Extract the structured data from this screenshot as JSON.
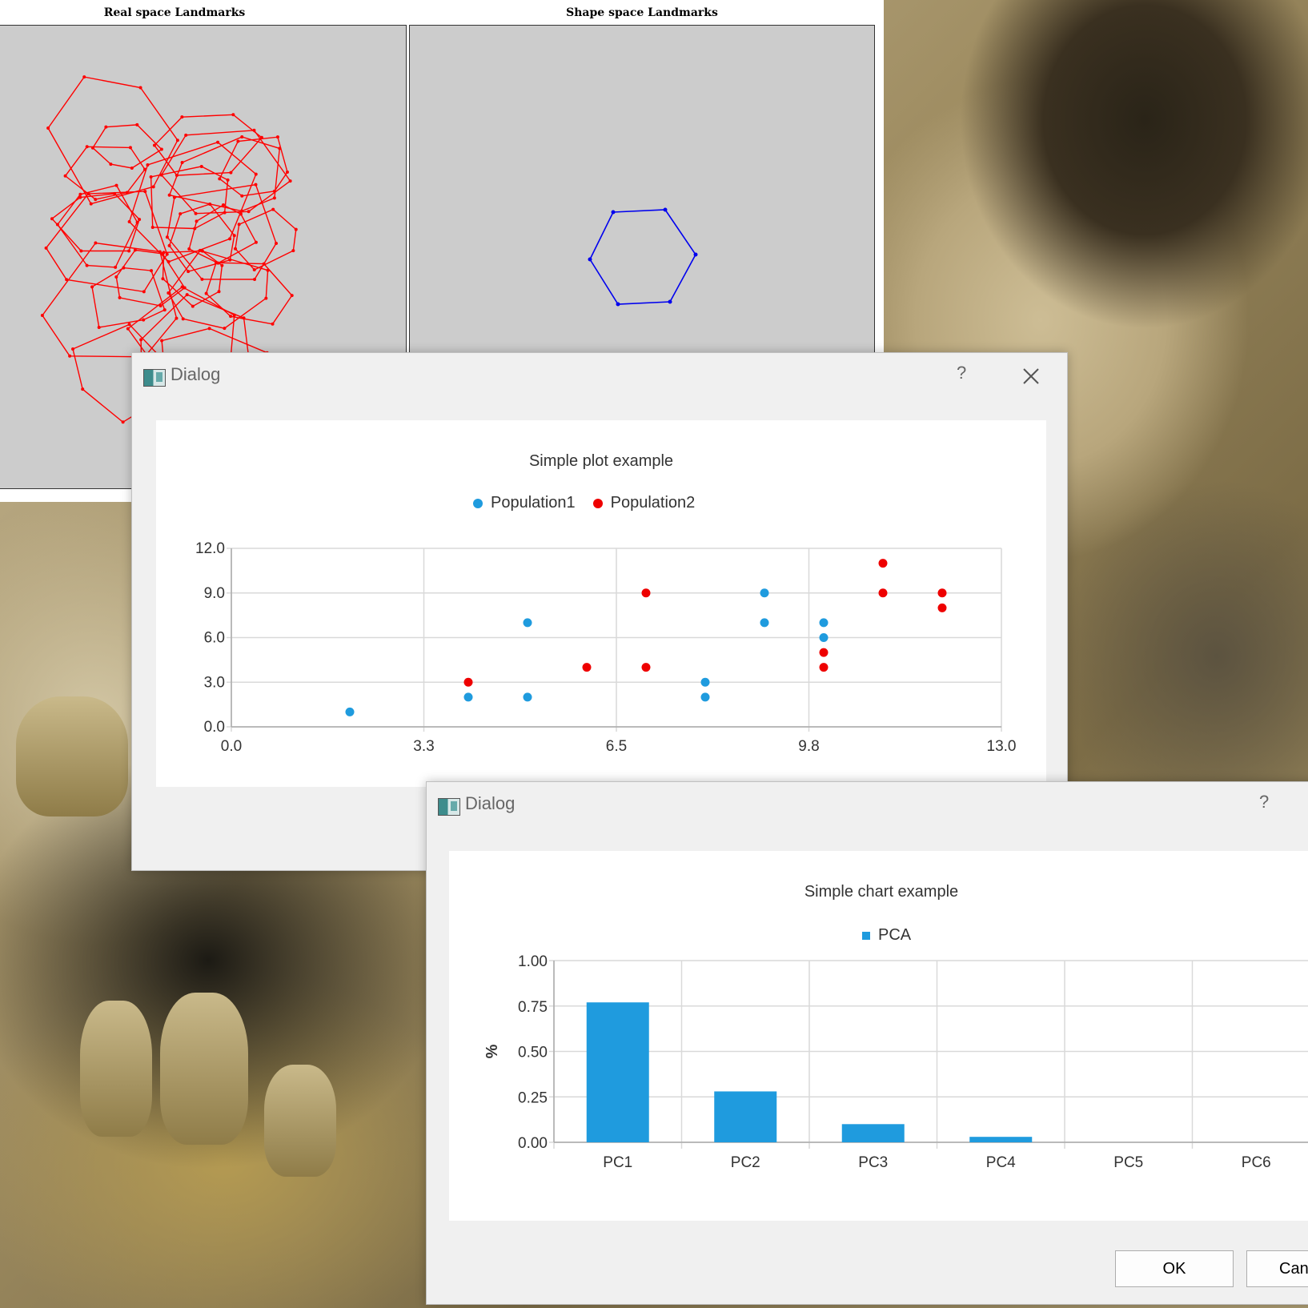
{
  "landmark_window": {
    "left_title": "Real space Landmarks",
    "right_title": "Shape space Landmarks",
    "real_line_color": "#ff0000",
    "shape_line_color": "#0000ee"
  },
  "scatter_dialog": {
    "title": "Dialog",
    "help_label": "?",
    "close_icon": "close-icon",
    "chart_data": {
      "type": "scatter",
      "title": "Simple plot example",
      "xlim": [
        0,
        13
      ],
      "ylim": [
        0,
        12
      ],
      "x_ticks": [
        "0.0",
        "3.3",
        "6.5",
        "9.8",
        "13.0"
      ],
      "y_ticks": [
        "0.0",
        "3.0",
        "6.0",
        "9.0",
        "12.0"
      ],
      "grid": true,
      "legend_position": "top",
      "series": [
        {
          "name": "Population1",
          "color": "#1f9bde",
          "points": [
            [
              2,
              1
            ],
            [
              4,
              2
            ],
            [
              5,
              2
            ],
            [
              5,
              7
            ],
            [
              8,
              2
            ],
            [
              8,
              3
            ],
            [
              9,
              7
            ],
            [
              9,
              9
            ],
            [
              10,
              6
            ],
            [
              10,
              7
            ]
          ]
        },
        {
          "name": "Population2",
          "color": "#ee0000",
          "points": [
            [
              4,
              3
            ],
            [
              6,
              4
            ],
            [
              7,
              4
            ],
            [
              7,
              9
            ],
            [
              10,
              4
            ],
            [
              10,
              5
            ],
            [
              11,
              9
            ],
            [
              11,
              11
            ],
            [
              12,
              8
            ],
            [
              12,
              9
            ]
          ]
        }
      ]
    }
  },
  "bar_dialog": {
    "title": "Dialog",
    "help_label": "?",
    "ok_label": "OK",
    "cancel_label": "Can",
    "chart_data": {
      "type": "bar",
      "title": "Simple chart example",
      "categories": [
        "PC1",
        "PC2",
        "PC3",
        "PC4",
        "PC5",
        "PC6"
      ],
      "series": [
        {
          "name": "PCA",
          "color": "#1f9bde",
          "values": [
            0.77,
            0.28,
            0.1,
            0.03,
            0.0,
            0.0
          ]
        }
      ],
      "ylabel": "%",
      "ylim": [
        0,
        1
      ],
      "y_ticks": [
        "0.00",
        "0.25",
        "0.50",
        "0.75",
        "1.00"
      ],
      "grid": true,
      "legend_position": "top"
    }
  }
}
